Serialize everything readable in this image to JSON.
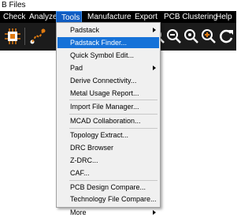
{
  "window": {
    "title": "B Files"
  },
  "menubar": {
    "items": [
      {
        "label": "Check",
        "active": false
      },
      {
        "label": "Analyze",
        "active": false
      },
      {
        "label": "Tools",
        "active": true
      },
      {
        "label": "Manufacture",
        "active": false
      },
      {
        "label": "Export",
        "active": false
      },
      {
        "label": "PCB Clustering",
        "active": false
      },
      {
        "label": "Help",
        "active": false
      }
    ]
  },
  "toolbar": {
    "icons": [
      "chip-icon",
      "connect-icon",
      "zoom-fit-icon",
      "zoom-out-icon",
      "zoom-previous-icon",
      "zoom-in-icon",
      "redraw-icon"
    ],
    "colors": {
      "orange": "#e07a10",
      "white": "#ffffff",
      "background": "#1b1b1b"
    }
  },
  "tools_menu": {
    "items": [
      {
        "label": "Padstack",
        "submenu": true,
        "highlighted": false
      },
      {
        "label": "Padstack Finder...",
        "submenu": false,
        "highlighted": true
      },
      {
        "label": "Quick Symbol Edit...",
        "submenu": false,
        "highlighted": false
      },
      {
        "label": "Pad",
        "submenu": true,
        "highlighted": false
      },
      {
        "label": "Derive Connectivity...",
        "submenu": false,
        "highlighted": false
      },
      {
        "label": "Metal Usage Report...",
        "submenu": false,
        "highlighted": false
      },
      {
        "label": "Import File Manager...",
        "submenu": false,
        "highlighted": false
      },
      {
        "label": "MCAD Collaboration...",
        "submenu": false,
        "highlighted": false
      },
      {
        "label": "Topology Extract...",
        "submenu": false,
        "highlighted": false
      },
      {
        "label": "DRC Browser",
        "submenu": false,
        "highlighted": false
      },
      {
        "label": "Z-DRC...",
        "submenu": false,
        "highlighted": false
      },
      {
        "label": "CAF...",
        "submenu": false,
        "highlighted": false
      },
      {
        "label": "PCB Design Compare...",
        "submenu": false,
        "highlighted": false
      },
      {
        "label": "Technology File Compare...",
        "submenu": false,
        "highlighted": false
      },
      {
        "label": "More",
        "submenu": true,
        "highlighted": false
      }
    ],
    "highlight_color": "#1672d8"
  }
}
